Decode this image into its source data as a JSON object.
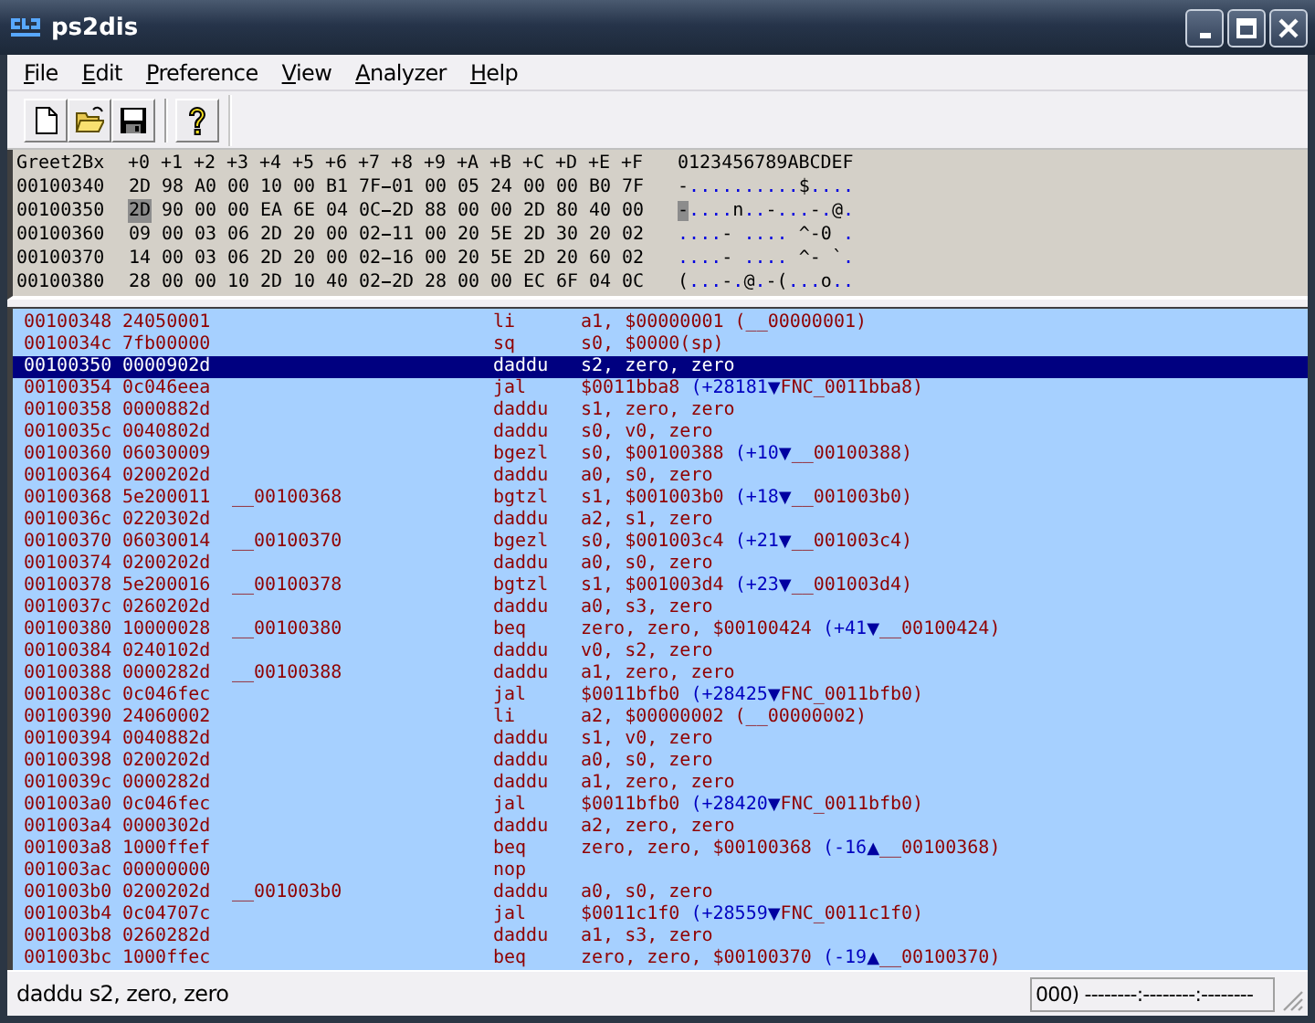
{
  "window": {
    "title": "ps2dis"
  },
  "menu": [
    {
      "label": "File"
    },
    {
      "label": "Edit"
    },
    {
      "label": "Preference"
    },
    {
      "label": "View"
    },
    {
      "label": "Analyzer"
    },
    {
      "label": "Help"
    }
  ],
  "toolbar": [
    {
      "kind": "new"
    },
    {
      "kind": "open"
    },
    {
      "kind": "save"
    },
    {
      "kind": "help"
    }
  ],
  "hex_view": {
    "columns": [
      "Greet2Bx",
      "+0",
      "+1",
      "+2",
      "+3",
      "+4",
      "+5",
      "+6",
      "+7",
      "+8",
      "+9",
      "+A",
      "+B",
      "+C",
      "+D",
      "+E",
      "+F",
      "0123456789ABCDEF"
    ],
    "rows": [
      {
        "address": "00100340",
        "bytes": [
          {
            "value": "2D",
            "selected": false
          },
          {
            "value": "98",
            "selected": false
          },
          {
            "value": "A0",
            "selected": false
          },
          {
            "value": "00",
            "selected": false
          },
          {
            "value": "10",
            "selected": false
          },
          {
            "value": "00",
            "selected": false
          },
          {
            "value": "B1",
            "selected": false
          },
          {
            "value": "7F",
            "selected": false
          },
          {
            "value": "01",
            "selected": false
          },
          {
            "value": "00",
            "selected": false
          },
          {
            "value": "05",
            "selected": false
          },
          {
            "value": "24",
            "selected": false
          },
          {
            "value": "00",
            "selected": false
          },
          {
            "value": "00",
            "selected": false
          },
          {
            "value": "B0",
            "selected": false
          },
          {
            "value": "7F",
            "selected": false
          }
        ],
        "ascii": "-..........$...."
      },
      {
        "address": "00100350",
        "bytes": [
          {
            "value": "2D",
            "selected": true
          },
          {
            "value": "90",
            "selected": false
          },
          {
            "value": "00",
            "selected": false
          },
          {
            "value": "00",
            "selected": false
          },
          {
            "value": "EA",
            "selected": false
          },
          {
            "value": "6E",
            "selected": false
          },
          {
            "value": "04",
            "selected": false
          },
          {
            "value": "0C",
            "selected": false
          },
          {
            "value": "2D",
            "selected": false
          },
          {
            "value": "88",
            "selected": false
          },
          {
            "value": "00",
            "selected": false
          },
          {
            "value": "00",
            "selected": false
          },
          {
            "value": "2D",
            "selected": false
          },
          {
            "value": "80",
            "selected": false
          },
          {
            "value": "40",
            "selected": false
          },
          {
            "value": "00",
            "selected": false
          }
        ],
        "ascii": "-....n..-...-.@."
      },
      {
        "address": "00100360",
        "bytes": [
          {
            "value": "09",
            "selected": false
          },
          {
            "value": "00",
            "selected": false
          },
          {
            "value": "03",
            "selected": false
          },
          {
            "value": "06",
            "selected": false
          },
          {
            "value": "2D",
            "selected": false
          },
          {
            "value": "20",
            "selected": false
          },
          {
            "value": "00",
            "selected": false
          },
          {
            "value": "02",
            "selected": false
          },
          {
            "value": "11",
            "selected": false
          },
          {
            "value": "00",
            "selected": false
          },
          {
            "value": "20",
            "selected": false
          },
          {
            "value": "5E",
            "selected": false
          },
          {
            "value": "2D",
            "selected": false
          },
          {
            "value": "30",
            "selected": false
          },
          {
            "value": "20",
            "selected": false
          },
          {
            "value": "02",
            "selected": false
          }
        ],
        "ascii": "....- .... ^-0 ."
      },
      {
        "address": "00100370",
        "bytes": [
          {
            "value": "14",
            "selected": false
          },
          {
            "value": "00",
            "selected": false
          },
          {
            "value": "03",
            "selected": false
          },
          {
            "value": "06",
            "selected": false
          },
          {
            "value": "2D",
            "selected": false
          },
          {
            "value": "20",
            "selected": false
          },
          {
            "value": "00",
            "selected": false
          },
          {
            "value": "02",
            "selected": false
          },
          {
            "value": "16",
            "selected": false
          },
          {
            "value": "00",
            "selected": false
          },
          {
            "value": "20",
            "selected": false
          },
          {
            "value": "5E",
            "selected": false
          },
          {
            "value": "2D",
            "selected": false
          },
          {
            "value": "20",
            "selected": false
          },
          {
            "value": "60",
            "selected": false
          },
          {
            "value": "02",
            "selected": false
          }
        ],
        "ascii": "....- .... ^- `."
      },
      {
        "address": "00100380",
        "bytes": [
          {
            "value": "28",
            "selected": false
          },
          {
            "value": "00",
            "selected": false
          },
          {
            "value": "00",
            "selected": false
          },
          {
            "value": "10",
            "selected": false
          },
          {
            "value": "2D",
            "selected": false
          },
          {
            "value": "10",
            "selected": false
          },
          {
            "value": "40",
            "selected": false
          },
          {
            "value": "02",
            "selected": false
          },
          {
            "value": "2D",
            "selected": false
          },
          {
            "value": "28",
            "selected": false
          },
          {
            "value": "00",
            "selected": false
          },
          {
            "value": "00",
            "selected": false
          },
          {
            "value": "EC",
            "selected": false
          },
          {
            "value": "6F",
            "selected": false
          },
          {
            "value": "04",
            "selected": false
          },
          {
            "value": "0C",
            "selected": false
          }
        ],
        "ascii": "(...-.@.-(...o.."
      }
    ]
  },
  "disassembly": {
    "rows": [
      {
        "address": "00100348",
        "code": "24050001",
        "mnemonic": "li",
        "operands": "a1, $00000001 (__00000001)",
        "selected": false
      },
      {
        "address": "0010034c",
        "code": "7fb00000",
        "mnemonic": "sq",
        "operands": "s0, $0000(sp)",
        "selected": false
      },
      {
        "address": "00100350",
        "code": "0000902d",
        "mnemonic": "daddu",
        "operands": "s2, zero, zero",
        "selected": true
      },
      {
        "address": "00100354",
        "code": "0c046eea",
        "mnemonic": "jal",
        "operands": "$0011bba8",
        "branch": {
          "offset": "(+28181",
          "arrow": "▼",
          "target": "FNC_0011bba8)"
        },
        "selected": false
      },
      {
        "address": "00100358",
        "code": "0000882d",
        "mnemonic": "daddu",
        "operands": "s1, zero, zero",
        "selected": false
      },
      {
        "address": "0010035c",
        "code": "0040802d",
        "mnemonic": "daddu",
        "operands": "s0, v0, zero",
        "selected": false
      },
      {
        "address": "00100360",
        "code": "06030009",
        "mnemonic": "bgezl",
        "operands": "s0, $00100388",
        "branch": {
          "offset": "(+10",
          "arrow": "▼",
          "target": "__00100388)"
        },
        "selected": false
      },
      {
        "address": "00100364",
        "code": "0200202d",
        "mnemonic": "daddu",
        "operands": "a0, s0, zero",
        "selected": false
      },
      {
        "address": "00100368",
        "code": "5e200011",
        "label": "__00100368",
        "mnemonic": "bgtzl",
        "operands": "s1, $001003b0",
        "branch": {
          "offset": "(+18",
          "arrow": "▼",
          "target": "__001003b0)"
        },
        "selected": false
      },
      {
        "address": "0010036c",
        "code": "0220302d",
        "mnemonic": "daddu",
        "operands": "a2, s1, zero",
        "selected": false
      },
      {
        "address": "00100370",
        "code": "06030014",
        "label": "__00100370",
        "mnemonic": "bgezl",
        "operands": "s0, $001003c4",
        "branch": {
          "offset": "(+21",
          "arrow": "▼",
          "target": "__001003c4)"
        },
        "selected": false
      },
      {
        "address": "00100374",
        "code": "0200202d",
        "mnemonic": "daddu",
        "operands": "a0, s0, zero",
        "selected": false
      },
      {
        "address": "00100378",
        "code": "5e200016",
        "label": "__00100378",
        "mnemonic": "bgtzl",
        "operands": "s1, $001003d4",
        "branch": {
          "offset": "(+23",
          "arrow": "▼",
          "target": "__001003d4)"
        },
        "selected": false
      },
      {
        "address": "0010037c",
        "code": "0260202d",
        "mnemonic": "daddu",
        "operands": "a0, s3, zero",
        "selected": false
      },
      {
        "address": "00100380",
        "code": "10000028",
        "label": "__00100380",
        "mnemonic": "beq",
        "operands": "zero, zero, $00100424",
        "branch": {
          "offset": "(+41",
          "arrow": "▼",
          "target": "__00100424)"
        },
        "selected": false
      },
      {
        "address": "00100384",
        "code": "0240102d",
        "mnemonic": "daddu",
        "operands": "v0, s2, zero",
        "selected": false
      },
      {
        "address": "00100388",
        "code": "0000282d",
        "label": "__00100388",
        "mnemonic": "daddu",
        "operands": "a1, zero, zero",
        "selected": false
      },
      {
        "address": "0010038c",
        "code": "0c046fec",
        "mnemonic": "jal",
        "operands": "$0011bfb0",
        "branch": {
          "offset": "(+28425",
          "arrow": "▼",
          "target": "FNC_0011bfb0)"
        },
        "selected": false
      },
      {
        "address": "00100390",
        "code": "24060002",
        "mnemonic": "li",
        "operands": "a2, $00000002 (__00000002)",
        "selected": false
      },
      {
        "address": "00100394",
        "code": "0040882d",
        "mnemonic": "daddu",
        "operands": "s1, v0, zero",
        "selected": false
      },
      {
        "address": "00100398",
        "code": "0200202d",
        "mnemonic": "daddu",
        "operands": "a0, s0, zero",
        "selected": false
      },
      {
        "address": "0010039c",
        "code": "0000282d",
        "mnemonic": "daddu",
        "operands": "a1, zero, zero",
        "selected": false
      },
      {
        "address": "001003a0",
        "code": "0c046fec",
        "mnemonic": "jal",
        "operands": "$0011bfb0",
        "branch": {
          "offset": "(+28420",
          "arrow": "▼",
          "target": "FNC_0011bfb0)"
        },
        "selected": false
      },
      {
        "address": "001003a4",
        "code": "0000302d",
        "mnemonic": "daddu",
        "operands": "a2, zero, zero",
        "selected": false
      },
      {
        "address": "001003a8",
        "code": "1000ffef",
        "mnemonic": "beq",
        "operands": "zero, zero, $00100368",
        "branch": {
          "offset": "(-16",
          "arrow": "▲",
          "target": "__00100368)"
        },
        "selected": false
      },
      {
        "address": "001003ac",
        "code": "00000000",
        "mnemonic": "nop",
        "operands": "",
        "selected": false
      },
      {
        "address": "001003b0",
        "code": "0200202d",
        "label": "__001003b0",
        "mnemonic": "daddu",
        "operands": "a0, s0, zero",
        "selected": false
      },
      {
        "address": "001003b4",
        "code": "0c04707c",
        "mnemonic": "jal",
        "operands": "$0011c1f0",
        "branch": {
          "offset": "(+28559",
          "arrow": "▼",
          "target": "FNC_0011c1f0)"
        },
        "selected": false
      },
      {
        "address": "001003b8",
        "code": "0260282d",
        "mnemonic": "daddu",
        "operands": "a1, s3, zero",
        "selected": false
      },
      {
        "address": "001003bc",
        "code": "1000ffec",
        "mnemonic": "beq",
        "operands": "zero, zero, $00100370",
        "branch": {
          "offset": "(-19",
          "arrow": "▲",
          "target": "__00100370)"
        },
        "selected": false
      }
    ]
  },
  "status_bar": {
    "instruction": "daddu s2, zero, zero",
    "position": "000) --------:--------:--------"
  }
}
